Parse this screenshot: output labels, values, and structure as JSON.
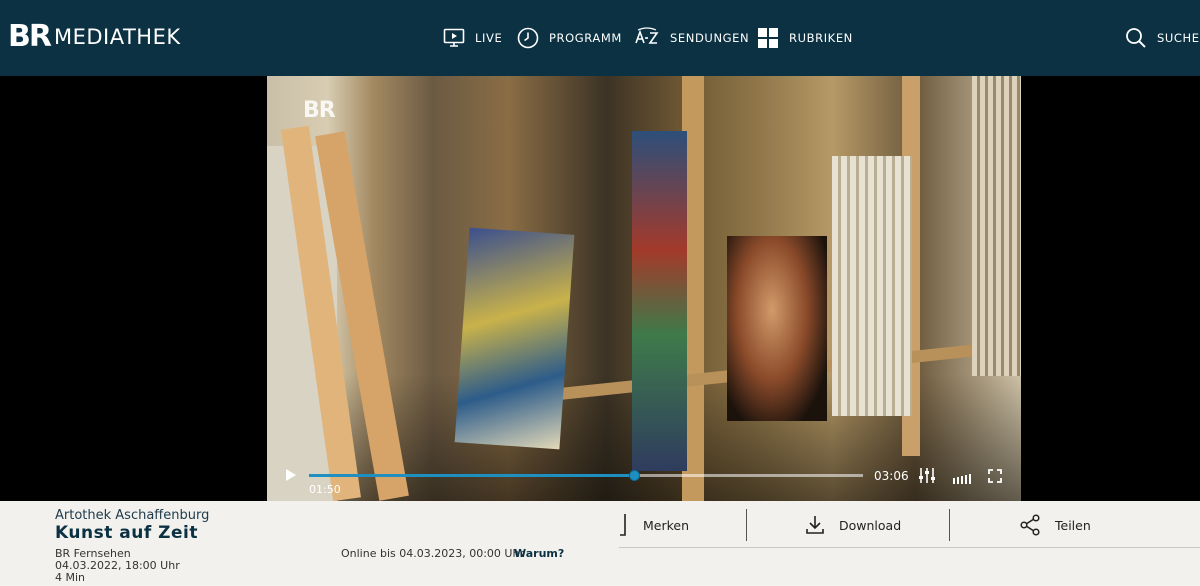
{
  "header": {
    "logo_br": "BR",
    "logo_word": "MEDIATHEK",
    "nav": [
      {
        "label": "LIVE",
        "icon": "tv-play-icon"
      },
      {
        "label": "PROGRAMM",
        "icon": "clock-icon"
      },
      {
        "label": "SENDUNGEN",
        "icon": "a-z-icon"
      },
      {
        "label": "RUBRIKEN",
        "icon": "grid-icon"
      }
    ],
    "search_label": "SUCHE"
  },
  "player": {
    "watermark": "BR",
    "current_time": "01:50",
    "duration": "03:06",
    "progress": 0.587
  },
  "info": {
    "subtitle": "Artothek Aschaffenburg",
    "title": "Kunst auf Zeit",
    "channel": "BR Fernsehen",
    "date": "04.03.2022, 18:00 Uhr",
    "length": "4 Min",
    "online_until": "Online bis 04.03.2023, 00:00 Uhr",
    "warum": "Warum?"
  },
  "actions": {
    "merken": "Merken",
    "download": "Download",
    "teilen": "Teilen"
  },
  "colors": {
    "header_bg": "#0b3142",
    "accent": "#1e8fbf",
    "info_bg": "#f2f1ee"
  }
}
